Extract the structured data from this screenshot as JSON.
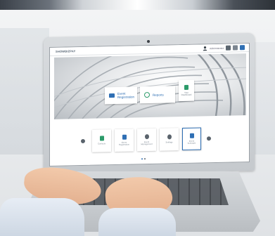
{
  "app": {
    "logo_text": "SHOWBIZPAY",
    "user_name": "Administrator"
  },
  "hero_tiles": [
    {
      "label": "Event\nRegistration",
      "icon": "briefcase-icon"
    },
    {
      "label": "Reports",
      "icon": "target-icon"
    },
    {
      "label": "Your\nDashboard",
      "icon": "user-icon"
    }
  ],
  "dock_items": [
    {
      "label": "Contacts",
      "icon": "person-icon",
      "color": "#2c9b6a"
    },
    {
      "label": "Event\nRegistration",
      "icon": "document-icon",
      "color": "#2f6fb4"
    },
    {
      "label": "Event\nManagement",
      "icon": "dollar-icon",
      "color": "#5a636c"
    },
    {
      "label": "Settings",
      "icon": "gear-icon",
      "color": "#5a636c"
    },
    {
      "label": "Event\nSchedule",
      "icon": "calendar-icon",
      "color": "#2f6fb4"
    }
  ],
  "colors": {
    "accent": "#2f6fb4",
    "green": "#2c9b6a"
  }
}
